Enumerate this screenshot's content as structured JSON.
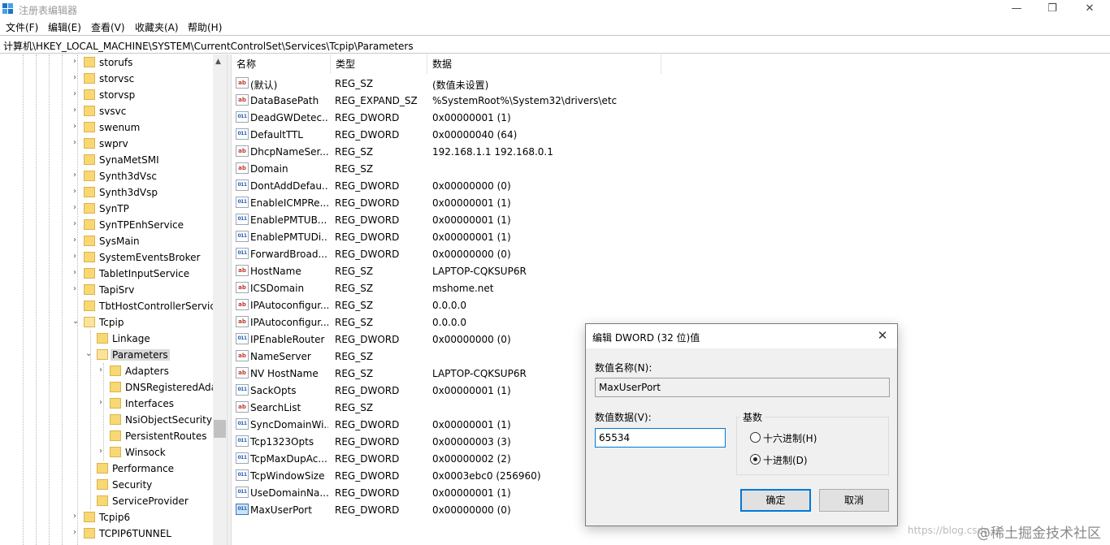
{
  "window": {
    "title": "注册表编辑器",
    "min": "—",
    "max": "❐",
    "close": "✕"
  },
  "menu": [
    "文件(F)",
    "编辑(E)",
    "查看(V)",
    "收藏夹(A)",
    "帮助(H)"
  ],
  "address": "计算机\\HKEY_LOCAL_MACHINE\\SYSTEM\\CurrentControlSet\\Services\\Tcpip\\Parameters",
  "tree": [
    {
      "label": "storufs"
    },
    {
      "label": "storvsc"
    },
    {
      "label": "storvsp"
    },
    {
      "label": "svsvc"
    },
    {
      "label": "swenum"
    },
    {
      "label": "swprv"
    },
    {
      "label": "SynaMetSMI"
    },
    {
      "label": "Synth3dVsc"
    },
    {
      "label": "Synth3dVsp"
    },
    {
      "label": "SynTP"
    },
    {
      "label": "SynTPEnhService"
    },
    {
      "label": "SysMain"
    },
    {
      "label": "SystemEventsBroker"
    },
    {
      "label": "TabletInputService"
    },
    {
      "label": "TapiSrv"
    },
    {
      "label": "TbtHostControllerServic"
    },
    {
      "label": "Tcpip"
    },
    {
      "label": "Linkage"
    },
    {
      "label": "Parameters"
    },
    {
      "label": "Adapters"
    },
    {
      "label": "DNSRegisteredAda"
    },
    {
      "label": "Interfaces"
    },
    {
      "label": "NsiObjectSecurity"
    },
    {
      "label": "PersistentRoutes"
    },
    {
      "label": "Winsock"
    },
    {
      "label": "Performance"
    },
    {
      "label": "Security"
    },
    {
      "label": "ServiceProvider"
    },
    {
      "label": "Tcpip6"
    },
    {
      "label": "TCPIP6TUNNEL"
    }
  ],
  "list": {
    "headers": [
      "名称",
      "类型",
      "数据"
    ],
    "rows": [
      {
        "name": "(默认)",
        "type": "REG_SZ",
        "data": "(数值未设置)",
        "icon": "ab"
      },
      {
        "name": "DataBasePath",
        "type": "REG_EXPAND_SZ",
        "data": "%SystemRoot%\\System32\\drivers\\etc",
        "icon": "ab"
      },
      {
        "name": "DeadGWDetec...",
        "type": "REG_DWORD",
        "data": "0x00000001 (1)",
        "icon": "011"
      },
      {
        "name": "DefaultTTL",
        "type": "REG_DWORD",
        "data": "0x00000040 (64)",
        "icon": "011"
      },
      {
        "name": "DhcpNameSer...",
        "type": "REG_SZ",
        "data": "192.168.1.1 192.168.0.1",
        "icon": "ab"
      },
      {
        "name": "Domain",
        "type": "REG_SZ",
        "data": "",
        "icon": "ab"
      },
      {
        "name": "DontAddDefau...",
        "type": "REG_DWORD",
        "data": "0x00000000 (0)",
        "icon": "011"
      },
      {
        "name": "EnableICMPRe...",
        "type": "REG_DWORD",
        "data": "0x00000001 (1)",
        "icon": "011"
      },
      {
        "name": "EnablePMTUB...",
        "type": "REG_DWORD",
        "data": "0x00000001 (1)",
        "icon": "011"
      },
      {
        "name": "EnablePMTUDi...",
        "type": "REG_DWORD",
        "data": "0x00000001 (1)",
        "icon": "011"
      },
      {
        "name": "ForwardBroad...",
        "type": "REG_DWORD",
        "data": "0x00000000 (0)",
        "icon": "011"
      },
      {
        "name": "HostName",
        "type": "REG_SZ",
        "data": "LAPTOP-CQKSUP6R",
        "icon": "ab"
      },
      {
        "name": "ICSDomain",
        "type": "REG_SZ",
        "data": "mshome.net",
        "icon": "ab"
      },
      {
        "name": "IPAutoconfigur...",
        "type": "REG_SZ",
        "data": "0.0.0.0",
        "icon": "ab"
      },
      {
        "name": "IPAutoconfigur...",
        "type": "REG_SZ",
        "data": "0.0.0.0",
        "icon": "ab"
      },
      {
        "name": "IPEnableRouter",
        "type": "REG_DWORD",
        "data": "0x00000000 (0)",
        "icon": "011"
      },
      {
        "name": "NameServer",
        "type": "REG_SZ",
        "data": "",
        "icon": "ab"
      },
      {
        "name": "NV HostName",
        "type": "REG_SZ",
        "data": "LAPTOP-CQKSUP6R",
        "icon": "ab"
      },
      {
        "name": "SackOpts",
        "type": "REG_DWORD",
        "data": "0x00000001 (1)",
        "icon": "011"
      },
      {
        "name": "SearchList",
        "type": "REG_SZ",
        "data": "",
        "icon": "ab"
      },
      {
        "name": "SyncDomainWi...",
        "type": "REG_DWORD",
        "data": "0x00000001 (1)",
        "icon": "011"
      },
      {
        "name": "Tcp1323Opts",
        "type": "REG_DWORD",
        "data": "0x00000003 (3)",
        "icon": "011"
      },
      {
        "name": "TcpMaxDupAc...",
        "type": "REG_DWORD",
        "data": "0x00000002 (2)",
        "icon": "011"
      },
      {
        "name": "TcpWindowSize",
        "type": "REG_DWORD",
        "data": "0x0003ebc0 (256960)",
        "icon": "011"
      },
      {
        "name": "UseDomainNa...",
        "type": "REG_DWORD",
        "data": "0x00000001 (1)",
        "icon": "011"
      },
      {
        "name": "MaxUserPort",
        "type": "REG_DWORD",
        "data": "0x00000000 (0)",
        "icon": "011"
      }
    ]
  },
  "dialog": {
    "title": "编辑 DWORD (32 位)值",
    "close": "✕",
    "name_label": "数值名称(N):",
    "name_value": "MaxUserPort",
    "data_label": "数值数据(V):",
    "data_value": "65534",
    "base_label": "基数",
    "hex_label": "十六进制(H)",
    "dec_label": "十进制(D)",
    "selected_base": "十进制(D)",
    "ok": "确定",
    "cancel": "取消"
  },
  "watermark": {
    "url": "https://blog.csdn.",
    "brand": "@稀土掘金技术社区"
  }
}
